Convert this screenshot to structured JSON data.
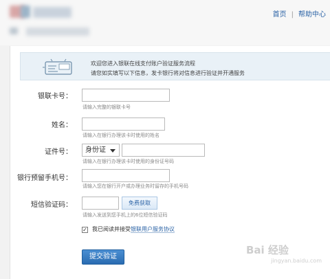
{
  "header": {
    "links": [
      "首页",
      "帮助中心"
    ],
    "separator": "|"
  },
  "banner": {
    "line1": "欢迎您进入银联在线支付账户验证服务流程",
    "line2": "请您如实填写以下信息，发卡银行将对信息进行验证并开通服务"
  },
  "form": {
    "card_number": {
      "label": "银联卡号：",
      "hint": "请输入完整的银联卡号"
    },
    "name": {
      "label": "姓名：",
      "hint": "请输入在银行办理该卡时使用的姓名"
    },
    "id": {
      "label": "证件号：",
      "type_selected": "身份证",
      "hint": "请输入在银行办理该卡时使用的身份证号码"
    },
    "phone": {
      "label": "银行预留手机号：",
      "hint": "请输入您在银行开户或办理业务时留存的手机号码"
    },
    "sms": {
      "label": "短信验证码：",
      "button": "免费获取",
      "hint": "请输入发送到您手机上的6位短信验证码"
    },
    "agreement": {
      "checked": true,
      "text": "我已阅读并接受",
      "link": "银联用户服务协议"
    },
    "submit": "提交验证"
  },
  "watermark": {
    "text": "Bai 经验",
    "sub": "jingyan.baidu.com"
  },
  "colors": {
    "link": "#2b63a6",
    "button": "#2a6cb1",
    "banner_bg": "#e9f1f7"
  }
}
